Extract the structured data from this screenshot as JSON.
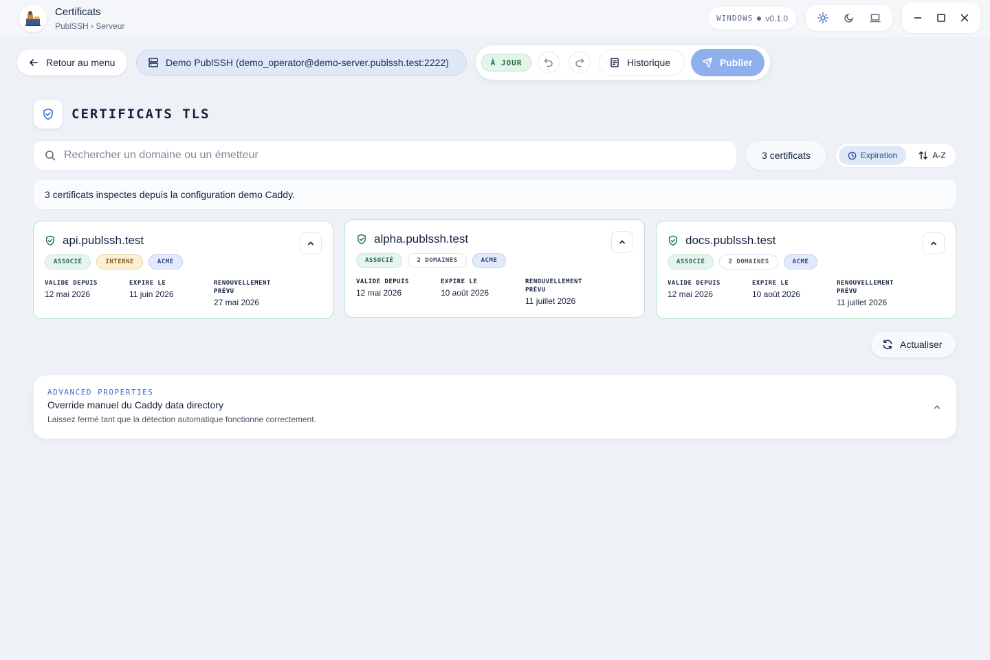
{
  "window": {
    "title": "Certificats",
    "breadcrumb": "PublSSH › Serveur",
    "os_label": "WINDOWS",
    "version": "v0.1.0"
  },
  "toolbar": {
    "back_label": "Retour au menu",
    "server_label": "Demo PublSSH (demo_operator@demo-server.publssh.test:2222)",
    "status_label": "À JOUR",
    "history_label": "Historique",
    "publish_label": "Publier"
  },
  "section": {
    "title": "CERTIFICATS TLS"
  },
  "search": {
    "placeholder": "Rechercher un domaine ou un émetteur",
    "value": "",
    "count_label": "3 certificats",
    "sort_expiration": "Expiration",
    "sort_az": "A-Z"
  },
  "info": {
    "message": "3 certificats inspectes depuis la configuration demo Caddy."
  },
  "date_labels": {
    "valid_from": "VALIDE DEPUIS",
    "expires": "EXPIRE LE",
    "renewal": "RENOUVELLEMENT PRÉVU"
  },
  "cards": [
    {
      "domain": "api.publssh.test",
      "tags": [
        {
          "label": "ASSOCIÉ",
          "kind": "assoc"
        },
        {
          "label": "INTERNE",
          "kind": "interne"
        },
        {
          "label": "ACME",
          "kind": "acme"
        }
      ],
      "valid_from": "12 mai 2026",
      "expires": "11 juin 2026",
      "renewal": "27 mai 2026"
    },
    {
      "domain": "alpha.publssh.test",
      "tags": [
        {
          "label": "ASSOCIÉ",
          "kind": "assoc"
        },
        {
          "label": "2 DOMAINES",
          "kind": "neutral"
        },
        {
          "label": "ACME",
          "kind": "acme"
        }
      ],
      "valid_from": "12 mai 2026",
      "expires": "10 août 2026",
      "renewal": "11 juillet 2026"
    },
    {
      "domain": "docs.publssh.test",
      "tags": [
        {
          "label": "ASSOCIÉ",
          "kind": "assoc"
        },
        {
          "label": "2 DOMAINES",
          "kind": "neutral"
        },
        {
          "label": "ACME",
          "kind": "acme"
        }
      ],
      "valid_from": "12 mai 2026",
      "expires": "10 août 2026",
      "renewal": "11 juillet 2026"
    }
  ],
  "refresh_label": "Actualiser",
  "advanced": {
    "eyebrow": "ADVANCED PROPERTIES",
    "title": "Override manuel du Caddy data directory",
    "description": "Laissez fermé tant que la détection automatique fonctionne correctement."
  },
  "colors": {
    "accent": "#8fb0ec",
    "success": "#1d6b3e",
    "card_border": "#b9e2d6"
  }
}
